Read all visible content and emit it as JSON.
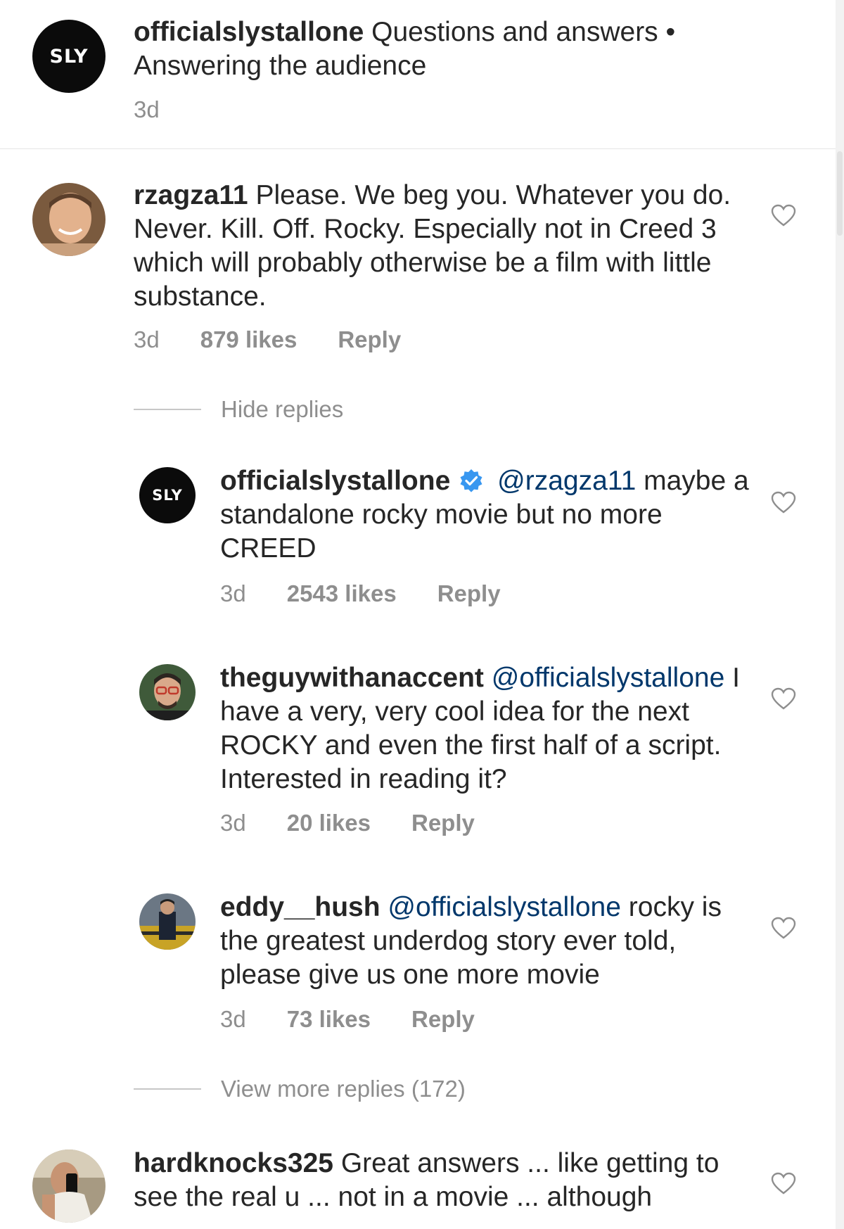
{
  "caption": {
    "avatar_text": "SLY",
    "username": "officialslystallone",
    "text": "Questions and answers • Answering the audience",
    "time": "3d"
  },
  "comments": [
    {
      "username": "rzagza11",
      "text": "Please. We beg you. Whatever you do. Never. Kill. Off. Rocky. Especially not in Creed 3 which will probably otherwise be a film with little substance.",
      "time": "3d",
      "likes": "879 likes",
      "reply": "Reply"
    }
  ],
  "hide_replies": "Hide replies",
  "replies": [
    {
      "username": "officialslystallone",
      "avatar_text": "SLY",
      "verified": true,
      "mention": "@rzagza11",
      "text": "maybe a standalone rocky movie but no more CREED",
      "time": "3d",
      "likes": "2543 likes",
      "reply": "Reply"
    },
    {
      "username": "theguywithanaccent",
      "mention": "@officialslystallone",
      "text": "I have a very, very cool idea for the next ROCKY and even the first half of a script. Interested in reading it?",
      "time": "3d",
      "likes": "20 likes",
      "reply": "Reply"
    },
    {
      "username": "eddy__hush",
      "mention": "@officialslystallone",
      "text": "rocky is the greatest underdog story ever told, please give us one more movie",
      "time": "3d",
      "likes": "73 likes",
      "reply": "Reply"
    }
  ],
  "view_more_replies": "View more replies (172)",
  "last_comment": {
    "username": "hardknocks325",
    "text": "Great answers ... like getting to see the real u ... not in a movie ... although"
  },
  "colors": {
    "text": "#262626",
    "meta": "#8e8e8e",
    "mention": "#00376b",
    "verified": "#3897f0",
    "divider": "#e6e6e6"
  }
}
